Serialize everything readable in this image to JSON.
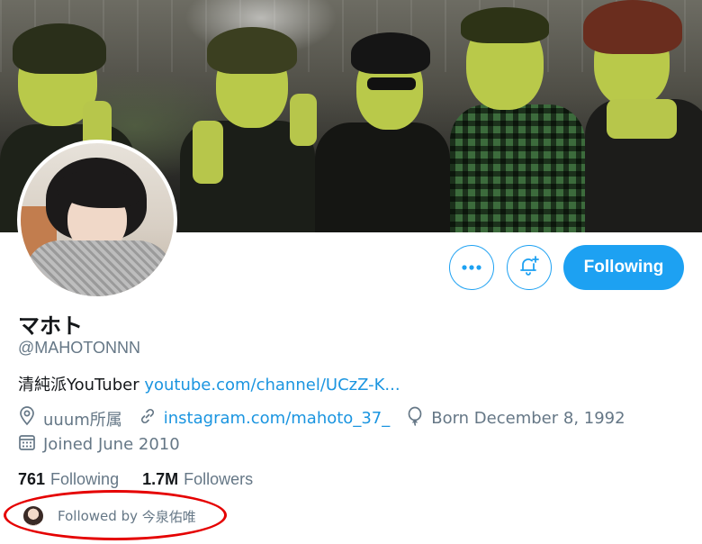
{
  "header_banner": {
    "icon": "group-photo"
  },
  "profile": {
    "display_name": "マホト",
    "handle": "@MAHOTONNN",
    "bio_text": "清純派YouTuber ",
    "bio_link": "youtube.com/channel/UCzZ-K...",
    "location": "uuum所属",
    "website": "instagram.com/mahoto_37_",
    "birthday": "Born December 8, 1992",
    "joined": "Joined June 2010"
  },
  "actions": {
    "more_icon": "more-icon",
    "notify_icon": "bell-plus-icon",
    "follow_label": "Following",
    "accent_color": "#1da1f2"
  },
  "stats": {
    "following_count": "761",
    "following_label": "Following",
    "followers_count": "1.7M",
    "followers_label": "Followers"
  },
  "followed_by": {
    "prefix": "Followed by ",
    "name": "今泉佑唯"
  },
  "annotation": {
    "color": "#e50000"
  }
}
